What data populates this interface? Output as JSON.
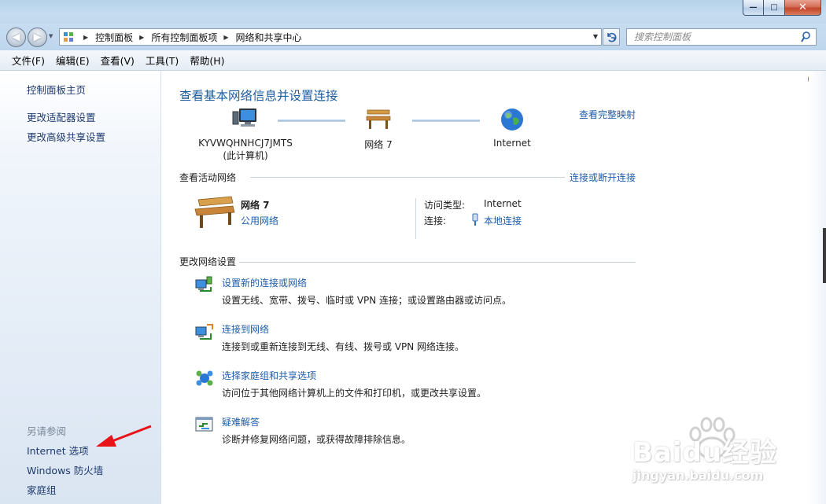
{
  "window": {
    "min_glyph": "—",
    "max_glyph": "□",
    "close_glyph": "✕"
  },
  "address_bar": {
    "back_glyph": "◀",
    "forward_glyph": "▶",
    "breadcrumbs": [
      "控制面板",
      "所有控制面板项",
      "网络和共享中心"
    ],
    "search_placeholder": "搜索控制面板"
  },
  "menu": {
    "items": [
      "文件(F)",
      "编辑(E)",
      "查看(V)",
      "工具(T)",
      "帮助(H)"
    ]
  },
  "sidebar": {
    "links": [
      "控制面板主页",
      "更改适配器设置",
      "更改高级共享设置"
    ],
    "see_also_title": "另请参阅",
    "see_also_links": [
      "Internet 选项",
      "Windows 防火墙",
      "家庭组"
    ]
  },
  "main": {
    "help_glyph": "?",
    "title": "查看基本网络信息并设置连接",
    "full_map_link": "查看完整映射",
    "network_map": {
      "computer_name": "KYVWQHNHCJ7JMTS",
      "computer_note": "(此计算机)",
      "network_name": "网络  7",
      "internet_label": "Internet"
    },
    "active_networks": {
      "header": "查看活动网络",
      "connect_link": "连接或断开连接",
      "network_name": "网络  7",
      "network_type": "公用网络",
      "access_type_label": "访问类型:",
      "access_type_value": "Internet",
      "connections_label": "连接:",
      "connection_value": "本地连接"
    },
    "change_settings": {
      "header": "更改网络设置",
      "tasks": [
        {
          "link": "设置新的连接或网络",
          "desc": "设置无线、宽带、拨号、临时或 VPN 连接；或设置路由器或访问点。",
          "icon": "new-connection-icon"
        },
        {
          "link": "连接到网络",
          "desc": "连接到或重新连接到无线、有线、拨号或 VPN 网络连接。",
          "icon": "connect-network-icon"
        },
        {
          "link": "选择家庭组和共享选项",
          "desc": "访问位于其他网络计算机上的文件和打印机，或更改共享设置。",
          "icon": "homegroup-icon"
        },
        {
          "link": "疑难解答",
          "desc": "诊断并修复网络问题，或获得故障排除信息。",
          "icon": "troubleshoot-icon"
        }
      ]
    }
  },
  "watermark": {
    "logo_text": "Baidu经验",
    "url": "jingyan.baidu.com"
  },
  "colors": {
    "link": "#1e5ca8",
    "title": "#1e5c9e",
    "annotation_arrow": "#e8141a"
  }
}
